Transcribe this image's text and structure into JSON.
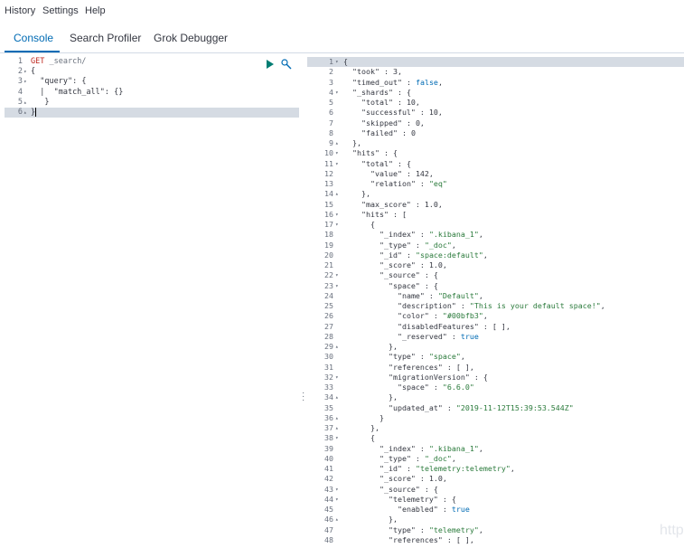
{
  "menu": {
    "history": "History",
    "settings": "Settings",
    "help": "Help"
  },
  "tabs": [
    {
      "label": "Console"
    },
    {
      "label": "Search Profiler"
    },
    {
      "label": "Grok Debugger"
    }
  ],
  "request": {
    "lines": [
      {
        "num": "1",
        "fold": "",
        "text": "GET _search/"
      },
      {
        "num": "2",
        "fold": "▾",
        "text": "{"
      },
      {
        "num": "3",
        "fold": "▾",
        "text": "  \"query\": {"
      },
      {
        "num": "4",
        "fold": "",
        "text": "  |  \"match_all\": {}"
      },
      {
        "num": "5",
        "fold": "▴",
        "text": "   }"
      },
      {
        "num": "6",
        "fold": "▴",
        "text": "}"
      }
    ]
  },
  "response": {
    "lines": [
      {
        "num": "1",
        "fold": "▾",
        "text": "{"
      },
      {
        "num": "2",
        "fold": "",
        "text": "  \"took\" : 3,"
      },
      {
        "num": "3",
        "fold": "",
        "text": "  \"timed_out\" : false,"
      },
      {
        "num": "4",
        "fold": "▾",
        "text": "  \"_shards\" : {"
      },
      {
        "num": "5",
        "fold": "",
        "text": "    \"total\" : 10,"
      },
      {
        "num": "6",
        "fold": "",
        "text": "    \"successful\" : 10,"
      },
      {
        "num": "7",
        "fold": "",
        "text": "    \"skipped\" : 0,"
      },
      {
        "num": "8",
        "fold": "",
        "text": "    \"failed\" : 0"
      },
      {
        "num": "9",
        "fold": "▴",
        "text": "  },"
      },
      {
        "num": "10",
        "fold": "▾",
        "text": "  \"hits\" : {"
      },
      {
        "num": "11",
        "fold": "▾",
        "text": "    \"total\" : {"
      },
      {
        "num": "12",
        "fold": "",
        "text": "      \"value\" : 142,"
      },
      {
        "num": "13",
        "fold": "",
        "text": "      \"relation\" : \"eq\""
      },
      {
        "num": "14",
        "fold": "▴",
        "text": "    },"
      },
      {
        "num": "15",
        "fold": "",
        "text": "    \"max_score\" : 1.0,"
      },
      {
        "num": "16",
        "fold": "▾",
        "text": "    \"hits\" : ["
      },
      {
        "num": "17",
        "fold": "▾",
        "text": "      {"
      },
      {
        "num": "18",
        "fold": "",
        "text": "        \"_index\" : \".kibana_1\","
      },
      {
        "num": "19",
        "fold": "",
        "text": "        \"_type\" : \"_doc\","
      },
      {
        "num": "20",
        "fold": "",
        "text": "        \"_id\" : \"space:default\","
      },
      {
        "num": "21",
        "fold": "",
        "text": "        \"_score\" : 1.0,"
      },
      {
        "num": "22",
        "fold": "▾",
        "text": "        \"_source\" : {"
      },
      {
        "num": "23",
        "fold": "▾",
        "text": "          \"space\" : {"
      },
      {
        "num": "24",
        "fold": "",
        "text": "            \"name\" : \"Default\","
      },
      {
        "num": "25",
        "fold": "",
        "text": "            \"description\" : \"This is your default space!\","
      },
      {
        "num": "26",
        "fold": "",
        "text": "            \"color\" : \"#00bfb3\","
      },
      {
        "num": "27",
        "fold": "",
        "text": "            \"disabledFeatures\" : [ ],"
      },
      {
        "num": "28",
        "fold": "",
        "text": "            \"_reserved\" : true"
      },
      {
        "num": "29",
        "fold": "▴",
        "text": "          },"
      },
      {
        "num": "30",
        "fold": "",
        "text": "          \"type\" : \"space\","
      },
      {
        "num": "31",
        "fold": "",
        "text": "          \"references\" : [ ],"
      },
      {
        "num": "32",
        "fold": "▾",
        "text": "          \"migrationVersion\" : {"
      },
      {
        "num": "33",
        "fold": "",
        "text": "            \"space\" : \"6.6.0\""
      },
      {
        "num": "34",
        "fold": "▴",
        "text": "          },"
      },
      {
        "num": "35",
        "fold": "",
        "text": "          \"updated_at\" : \"2019-11-12T15:39:53.544Z\""
      },
      {
        "num": "36",
        "fold": "▴",
        "text": "        }"
      },
      {
        "num": "37",
        "fold": "▴",
        "text": "      },"
      },
      {
        "num": "38",
        "fold": "▾",
        "text": "      {"
      },
      {
        "num": "39",
        "fold": "",
        "text": "        \"_index\" : \".kibana_1\","
      },
      {
        "num": "40",
        "fold": "",
        "text": "        \"_type\" : \"_doc\","
      },
      {
        "num": "41",
        "fold": "",
        "text": "        \"_id\" : \"telemetry:telemetry\","
      },
      {
        "num": "42",
        "fold": "",
        "text": "        \"_score\" : 1.0,"
      },
      {
        "num": "43",
        "fold": "▾",
        "text": "        \"_source\" : {"
      },
      {
        "num": "44",
        "fold": "▾",
        "text": "          \"telemetry\" : {"
      },
      {
        "num": "45",
        "fold": "",
        "text": "            \"enabled\" : true"
      },
      {
        "num": "46",
        "fold": "▴",
        "text": "          },"
      },
      {
        "num": "47",
        "fold": "",
        "text": "          \"type\" : \"telemetry\","
      },
      {
        "num": "48",
        "fold": "",
        "text": "          \"references\" : [ ],"
      }
    ]
  },
  "watermark": "http",
  "colors": {
    "accent": "#006bb4",
    "run": "#017d73",
    "active_line": "#d5dbe3"
  },
  "icons": {
    "run": "play-icon",
    "settings": "wrench-icon"
  }
}
